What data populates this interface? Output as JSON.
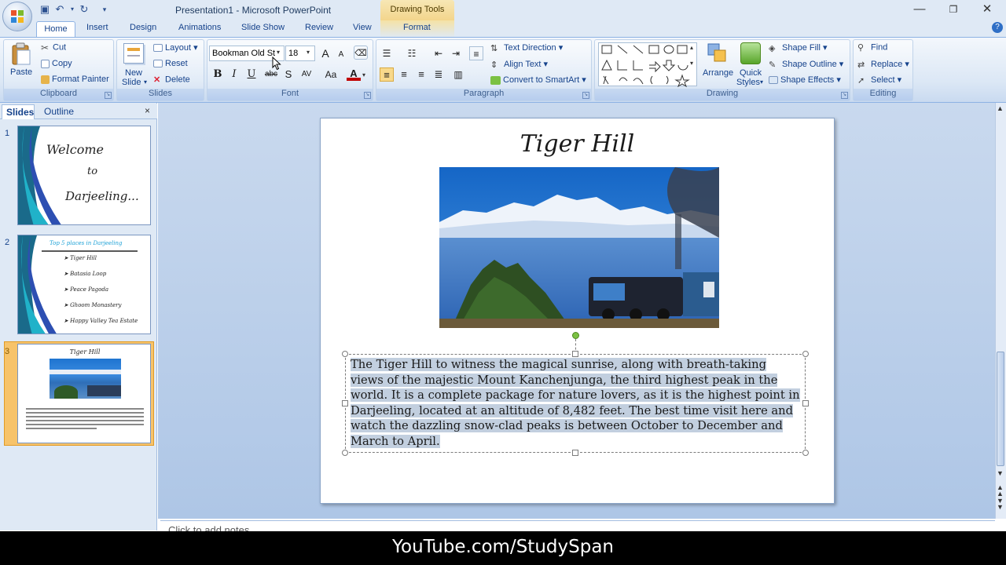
{
  "window": {
    "title": "Presentation1 - Microsoft PowerPoint",
    "context_tab_group": "Drawing Tools"
  },
  "tabs": [
    "Home",
    "Insert",
    "Design",
    "Animations",
    "Slide Show",
    "Review",
    "View",
    "Format"
  ],
  "ribbon": {
    "clipboard": {
      "label": "Clipboard",
      "paste": "Paste",
      "cut": "Cut",
      "copy": "Copy",
      "format_painter": "Format Painter"
    },
    "slides": {
      "label": "Slides",
      "new_slide_line1": "New",
      "new_slide_line2": "Slide",
      "layout": "Layout",
      "reset": "Reset",
      "delete": "Delete"
    },
    "font": {
      "label": "Font",
      "font_name": "Bookman Old St",
      "font_size": "18",
      "bold": "B",
      "italic": "I",
      "underline": "U",
      "strike": "abc",
      "shadow": "S",
      "spacing": "AV",
      "case": "Aa",
      "color": "A",
      "grow": "A",
      "shrink": "A"
    },
    "paragraph": {
      "label": "Paragraph",
      "text_direction": "Text Direction",
      "align_text": "Align Text",
      "convert_smartart": "Convert to SmartArt"
    },
    "drawing": {
      "label": "Drawing",
      "arrange": "Arrange",
      "quick_styles_line1": "Quick",
      "quick_styles_line2": "Styles",
      "shape_fill": "Shape Fill",
      "shape_outline": "Shape Outline",
      "shape_effects": "Shape Effects"
    },
    "editing": {
      "label": "Editing",
      "find": "Find",
      "replace": "Replace",
      "select": "Select"
    }
  },
  "pane": {
    "tab_slides": "Slides",
    "tab_outline": "Outline",
    "close": "×"
  },
  "thumbnails": [
    {
      "number": "1",
      "lines": [
        "Welcome",
        "to",
        "Darjeeling..."
      ]
    },
    {
      "number": "2",
      "heading": "Top 5 places in Darjeeling",
      "items": [
        "Tiger Hill",
        "Batasia Loop",
        "Peace Pagoda",
        "Ghoom Monastery",
        "Happy Valley Tea Estate"
      ]
    },
    {
      "number": "3",
      "title": "Tiger Hill"
    }
  ],
  "slide": {
    "title": "Tiger Hill",
    "body": "The Tiger Hill to witness the magical sunrise, along with breath-taking views of the majestic Mount Kanchenjunga, the third highest peak in the world. It is a complete package for nature lovers, as it is the highest point in Darjeeling, located at an altitude of 8,482 feet. The best time visit here and watch the dazzling snow-clad peaks is between October to December and March to April."
  },
  "notes_placeholder": "Click to add notes",
  "watermark": "YouTube.com/StudySpan",
  "colors": {
    "ribbon_bg": "#dfe9f5",
    "accent": "#15428b",
    "selected_thumb": "#f7c36a",
    "text_highlight": "#c2cfdf"
  }
}
